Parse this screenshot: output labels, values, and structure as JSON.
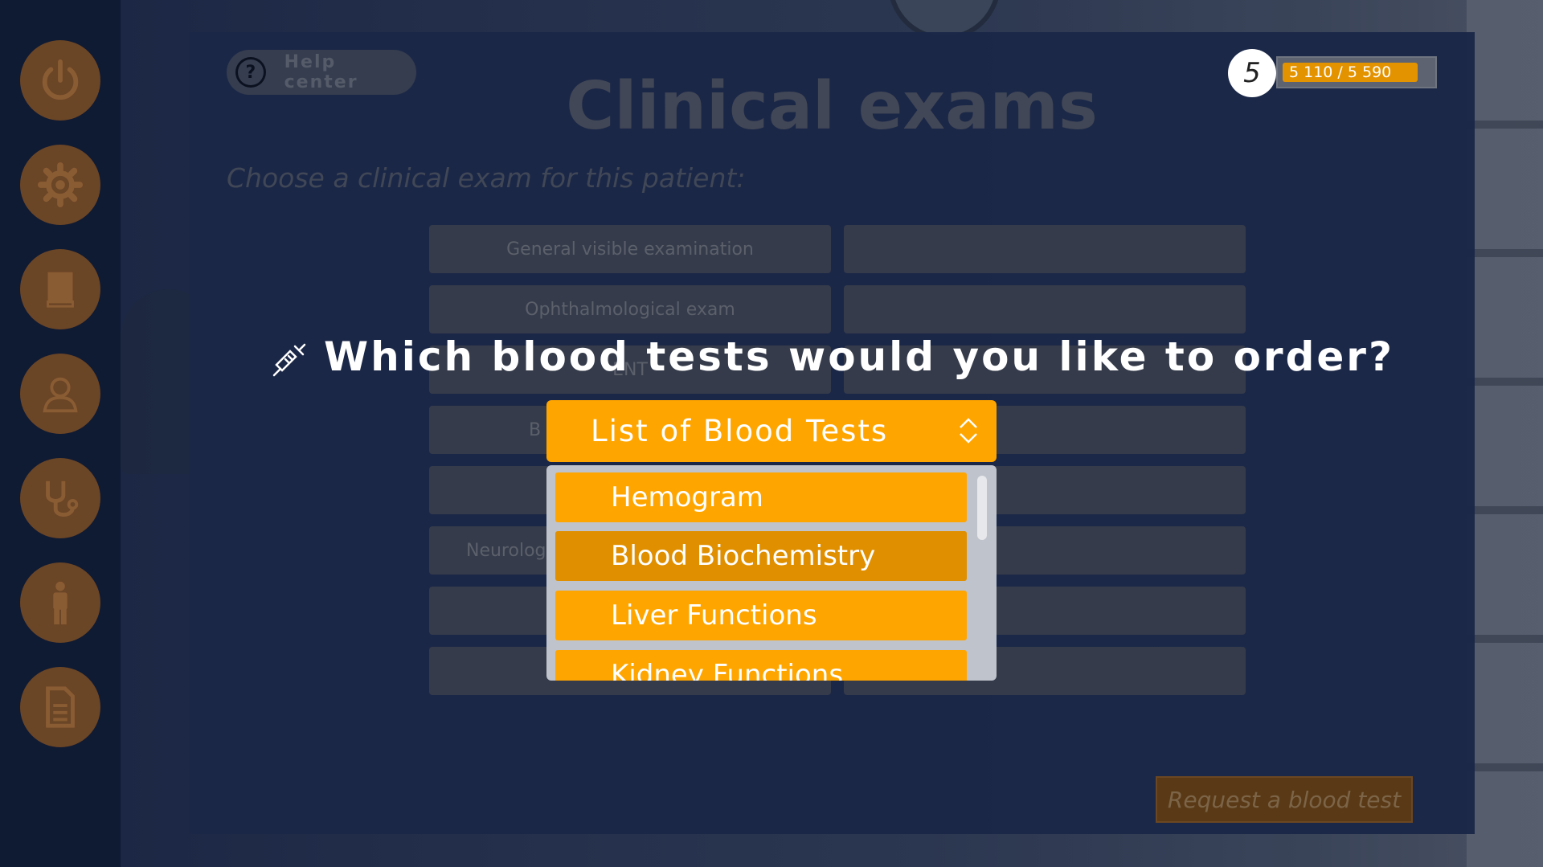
{
  "sidebar": {
    "items": [
      {
        "icon": "power-icon"
      },
      {
        "icon": "gear-icon"
      },
      {
        "icon": "book-icon"
      },
      {
        "icon": "doctor-icon"
      },
      {
        "icon": "stethoscope-icon"
      },
      {
        "icon": "person-icon"
      },
      {
        "icon": "document-icon"
      }
    ]
  },
  "header": {
    "help_label": "Help center",
    "title": "Clinical exams",
    "subtitle": "Choose a clinical exam for this patient:"
  },
  "score": {
    "level": "5",
    "progress_text": "5 110 / 5 590",
    "progress_fraction": 0.914
  },
  "exams": {
    "left": [
      "General visible examination",
      "Ophthalmological exam",
      "ENT",
      "B",
      "",
      "Neurolog",
      "",
      ""
    ],
    "right": [
      "",
      "",
      "",
      "",
      "",
      "",
      "",
      ""
    ]
  },
  "modal": {
    "question": "Which blood tests would you like to order?",
    "dropdown_title": "List of Blood Tests",
    "options": [
      "Hemogram",
      "Blood Biochemistry",
      "Liver Functions",
      "Kidney Functions"
    ]
  },
  "footer": {
    "request_label": "Request a blood test"
  },
  "colors": {
    "accent": "#ffa500",
    "accent_hover": "#e08f00",
    "panel": "#1b2747",
    "sidebar_btn": "#6a4526"
  }
}
